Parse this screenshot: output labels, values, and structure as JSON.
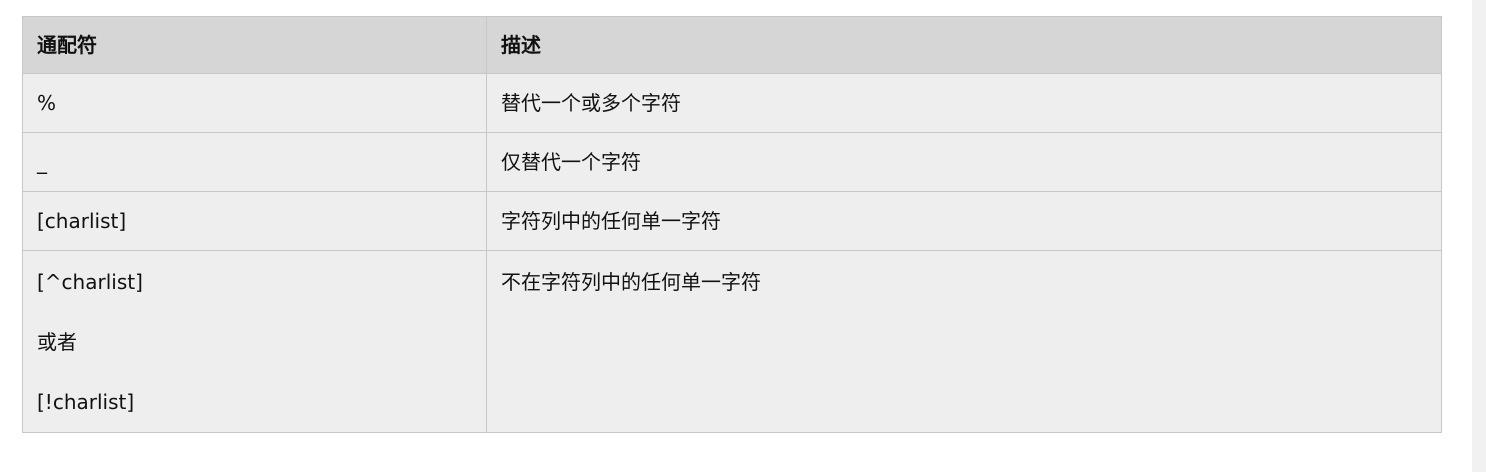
{
  "table": {
    "headers": [
      "通配符",
      "描述"
    ],
    "rows": [
      {
        "wildcard": "%",
        "description": "替代一个或多个字符"
      },
      {
        "wildcard": "_",
        "description": "仅替代一个字符"
      },
      {
        "wildcard": "[charlist]",
        "description": "字符列中的任何单一字符"
      },
      {
        "wildcard_lines": [
          "[^charlist]",
          "或者",
          "[!charlist]"
        ],
        "description": "不在字符列中的任何单一字符"
      }
    ]
  }
}
